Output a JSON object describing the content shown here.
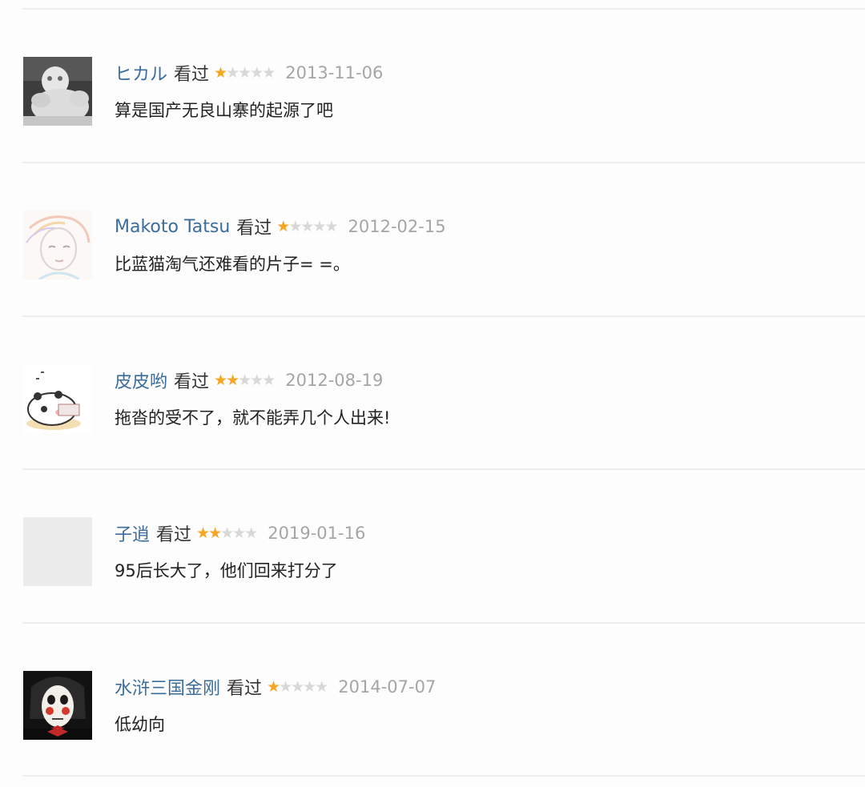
{
  "comments": [
    {
      "user": "ヒカル",
      "status": "看过",
      "rating": 1,
      "max_rating": 5,
      "date": "2013-11-06",
      "text": "算是国产无良山寨的起源了吧",
      "avatar": "white-figure-avatar"
    },
    {
      "user": "Makoto Tatsu",
      "status": "看过",
      "rating": 1,
      "max_rating": 5,
      "date": "2012-02-15",
      "text": "比蓝猫淘气还难看的片子= =。",
      "avatar": "anime-sketch-avatar"
    },
    {
      "user": "皮皮哟",
      "status": "看过",
      "rating": 2,
      "max_rating": 5,
      "date": "2012-08-19",
      "text": "拖沓的受不了，就不能弄几个人出来!",
      "avatar": "panda-cartoon-avatar"
    },
    {
      "user": "子逍",
      "status": "看过",
      "rating": 2,
      "max_rating": 5,
      "date": "2019-01-16",
      "text": "95后长大了，他们回来打分了",
      "avatar": "default-gray-avatar"
    },
    {
      "user": "水浒三国金刚",
      "status": "看过",
      "rating": 1,
      "max_rating": 5,
      "date": "2014-07-07",
      "text": "低幼向",
      "avatar": "jigsaw-puppet-avatar"
    }
  ],
  "colors": {
    "username": "#3b6d9c",
    "star_on": "#f5a623",
    "star_off": "#d8d8d8",
    "date": "#a5a5a5",
    "text": "#222222",
    "separator": "#eeeeee"
  }
}
